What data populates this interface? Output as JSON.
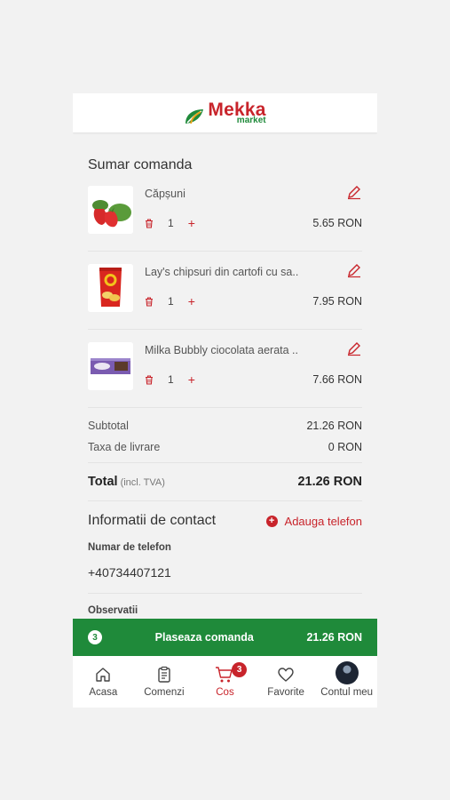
{
  "header": {
    "logo_main": "Mekka",
    "logo_sub": "market"
  },
  "summary": {
    "title": "Sumar comanda",
    "items": [
      {
        "name": "Căpșuni",
        "qty": "1",
        "price": "5.65 RON",
        "image": "strawberries"
      },
      {
        "name": "Lay's chipsuri din cartofi cu sa..",
        "qty": "1",
        "price": "7.95 RON",
        "image": "chips-bag"
      },
      {
        "name": "Milka Bubbly ciocolata aerata ..",
        "qty": "1",
        "price": "7.66 RON",
        "image": "chocolate-bar"
      }
    ],
    "subtotal_label": "Subtotal",
    "subtotal_value": "21.26 RON",
    "delivery_label": "Taxa de livrare",
    "delivery_value": "0 RON",
    "total_label": "Total",
    "total_note": "(incl. TVA)",
    "total_value": "21.26 RON"
  },
  "contact": {
    "title": "Informatii de contact",
    "add_phone_label": "Adauga telefon",
    "phone_label": "Numar de telefon",
    "phone_value": "+40734407121",
    "notes_label": "Observatii"
  },
  "order_bar": {
    "count": "3",
    "label": "Plaseaza comanda",
    "total": "21.26 RON"
  },
  "nav": {
    "items": [
      {
        "label": "Acasa",
        "icon": "home-icon"
      },
      {
        "label": "Comenzi",
        "icon": "clipboard-icon"
      },
      {
        "label": "Cos",
        "icon": "cart-icon",
        "badge": "3",
        "active": true
      },
      {
        "label": "Favorite",
        "icon": "heart-icon"
      },
      {
        "label": "Contul meu",
        "icon": "avatar"
      }
    ]
  },
  "colors": {
    "brand_red": "#c8242b",
    "brand_green": "#1f8a3a"
  }
}
